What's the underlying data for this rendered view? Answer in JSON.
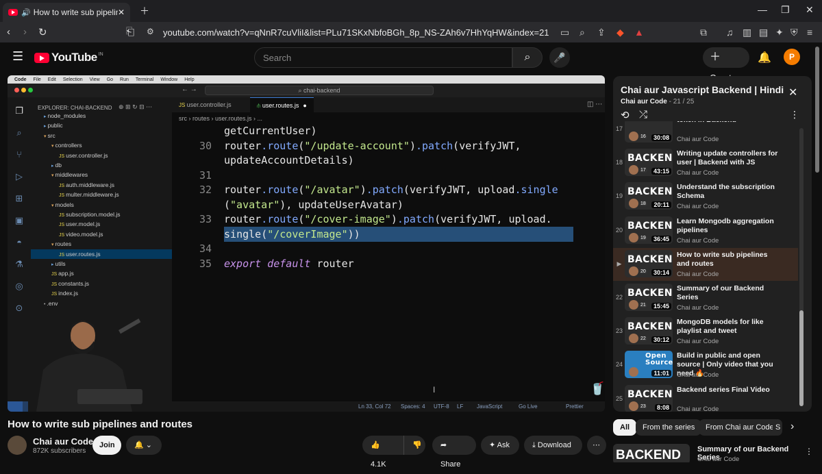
{
  "browser": {
    "tab_title": "How to write sub pipelines ar",
    "url": "youtube.com/watch?v=qNnR7cuVliI&list=PLu71SKxNbfoBGh_8p_NS-ZAh6v7HhYqHW&index=21"
  },
  "header": {
    "logo_text": "YouTube",
    "region": "IN",
    "search_placeholder": "Search",
    "create_label": "Create",
    "avatar_letter": "P"
  },
  "vscode": {
    "menu": [
      "Code",
      "File",
      "Edit",
      "Selection",
      "View",
      "Go",
      "Run",
      "Terminal",
      "Window",
      "Help"
    ],
    "command_center": "chai-backend",
    "explorer_title": "EXPLORER: CHAI-BACKEND",
    "tree": [
      {
        "label": "node_modules",
        "depth": 1,
        "type": "folder"
      },
      {
        "label": "public",
        "depth": 1,
        "type": "folder"
      },
      {
        "label": "src",
        "depth": 1,
        "type": "folder-open"
      },
      {
        "label": "controllers",
        "depth": 2,
        "type": "folder-open"
      },
      {
        "label": "user.controller.js",
        "depth": 3,
        "type": "js"
      },
      {
        "label": "db",
        "depth": 2,
        "type": "folder"
      },
      {
        "label": "middlewares",
        "depth": 2,
        "type": "folder-open"
      },
      {
        "label": "auth.middleware.js",
        "depth": 3,
        "type": "js"
      },
      {
        "label": "multer.middleware.js",
        "depth": 3,
        "type": "js"
      },
      {
        "label": "models",
        "depth": 2,
        "type": "folder-open"
      },
      {
        "label": "subscription.model.js",
        "depth": 3,
        "type": "js"
      },
      {
        "label": "user.model.js",
        "depth": 3,
        "type": "js"
      },
      {
        "label": "video.model.js",
        "depth": 3,
        "type": "js"
      },
      {
        "label": "routes",
        "depth": 2,
        "type": "folder-open"
      },
      {
        "label": "user.routes.js",
        "depth": 3,
        "type": "js",
        "selected": true
      },
      {
        "label": "utils",
        "depth": 2,
        "type": "folder"
      },
      {
        "label": "app.js",
        "depth": 2,
        "type": "js"
      },
      {
        "label": "constants.js",
        "depth": 2,
        "type": "js"
      },
      {
        "label": "index.js",
        "depth": 2,
        "type": "js"
      },
      {
        "label": ".env",
        "depth": 1,
        "type": "file"
      }
    ],
    "tabs": [
      "user.controller.js",
      "user.routes.js"
    ],
    "breadcrumb": "src › routes › user.routes.js › ...",
    "code_lines": [
      {
        "num": "",
        "text": "getCurrentUser)"
      },
      {
        "num": "30",
        "text": "router.route(\"/update-account\").patch(verifyJWT,"
      },
      {
        "num": "",
        "text": "updateAccountDetails)"
      },
      {
        "num": "31",
        "text": ""
      },
      {
        "num": "32",
        "text": "router.route(\"/avatar\").patch(verifyJWT, upload.single"
      },
      {
        "num": "",
        "text": "(\"avatar\"), updateUserAvatar)"
      },
      {
        "num": "33",
        "text": "router.route(\"/cover-image\").patch(verifyJWT, upload."
      },
      {
        "num": "",
        "text": "single(\"/coverImage\"))",
        "highlight": true
      },
      {
        "num": "34",
        "text": ""
      },
      {
        "num": "35",
        "text": "export default router"
      }
    ],
    "status": {
      "position": "Ln 33, Col 72",
      "spaces": "Spaces: 4",
      "encoding": "UTF-8",
      "eol": "LF",
      "language": "JavaScript",
      "live": "Go Live",
      "prettier": "Prettier"
    }
  },
  "video": {
    "title": "How to write sub pipelines and routes",
    "channel": "Chai aur Code",
    "subscribers": "872K subscribers",
    "join_label": "Join",
    "likes": "4.1K",
    "share_label": "Share",
    "ask_label": "Ask",
    "download_label": "Download"
  },
  "playlist": {
    "title": "Chai aur Javascript Backend | Hindi",
    "channel": "Chai aur Code",
    "position": "21 / 25",
    "items": [
      {
        "index": "17",
        "title": "token in Backend",
        "channel": "Chai aur Code",
        "duration": "30:08",
        "ep": "16",
        "thumb_text": ""
      },
      {
        "index": "18",
        "title": "Writing update controllers for user | Backend with JS",
        "channel": "Chai aur Code",
        "duration": "43:15",
        "ep": "17",
        "thumb_text": "BACKEND"
      },
      {
        "index": "19",
        "title": "Understand the subscription Schema",
        "channel": "Chai aur Code",
        "duration": "20:11",
        "ep": "18",
        "thumb_text": "BACKEND"
      },
      {
        "index": "20",
        "title": "Learn Mongodb aggregation pipelines",
        "channel": "Chai aur Code",
        "duration": "36:45",
        "ep": "19",
        "thumb_text": "BACKEND"
      },
      {
        "index": "▶",
        "title": "How to write sub pipelines and routes",
        "channel": "Chai aur Code",
        "duration": "30:14",
        "ep": "20",
        "thumb_text": "BACKEND",
        "current": true
      },
      {
        "index": "22",
        "title": "Summary of our Backend Series",
        "channel": "Chai aur Code",
        "duration": "15:45",
        "ep": "21",
        "thumb_text": "BACKEND"
      },
      {
        "index": "23",
        "title": "MongoDB models for like playlist and tweet",
        "channel": "Chai aur Code",
        "duration": "30:12",
        "ep": "22",
        "thumb_text": "BACKEND"
      },
      {
        "index": "24",
        "title": "Build in public and open source | Only video that you need 🔥",
        "channel": "Chai aur Code",
        "duration": "11:01",
        "ep": "",
        "thumb_text": "Open Source"
      },
      {
        "index": "25",
        "title": "Backend series Final Video",
        "channel": "Chai aur Code",
        "duration": "8:08",
        "ep": "23",
        "thumb_text": "BACKEND"
      }
    ]
  },
  "chips": [
    "All",
    "From the series",
    "From Chai aur Code",
    "S"
  ],
  "next_video": {
    "title": "Summary of our Backend Series",
    "channel": "Chai aur Code",
    "thumb_text": "BACKEND"
  },
  "colors": {
    "accent_red": "#ff0033",
    "selection": "#264f78"
  }
}
